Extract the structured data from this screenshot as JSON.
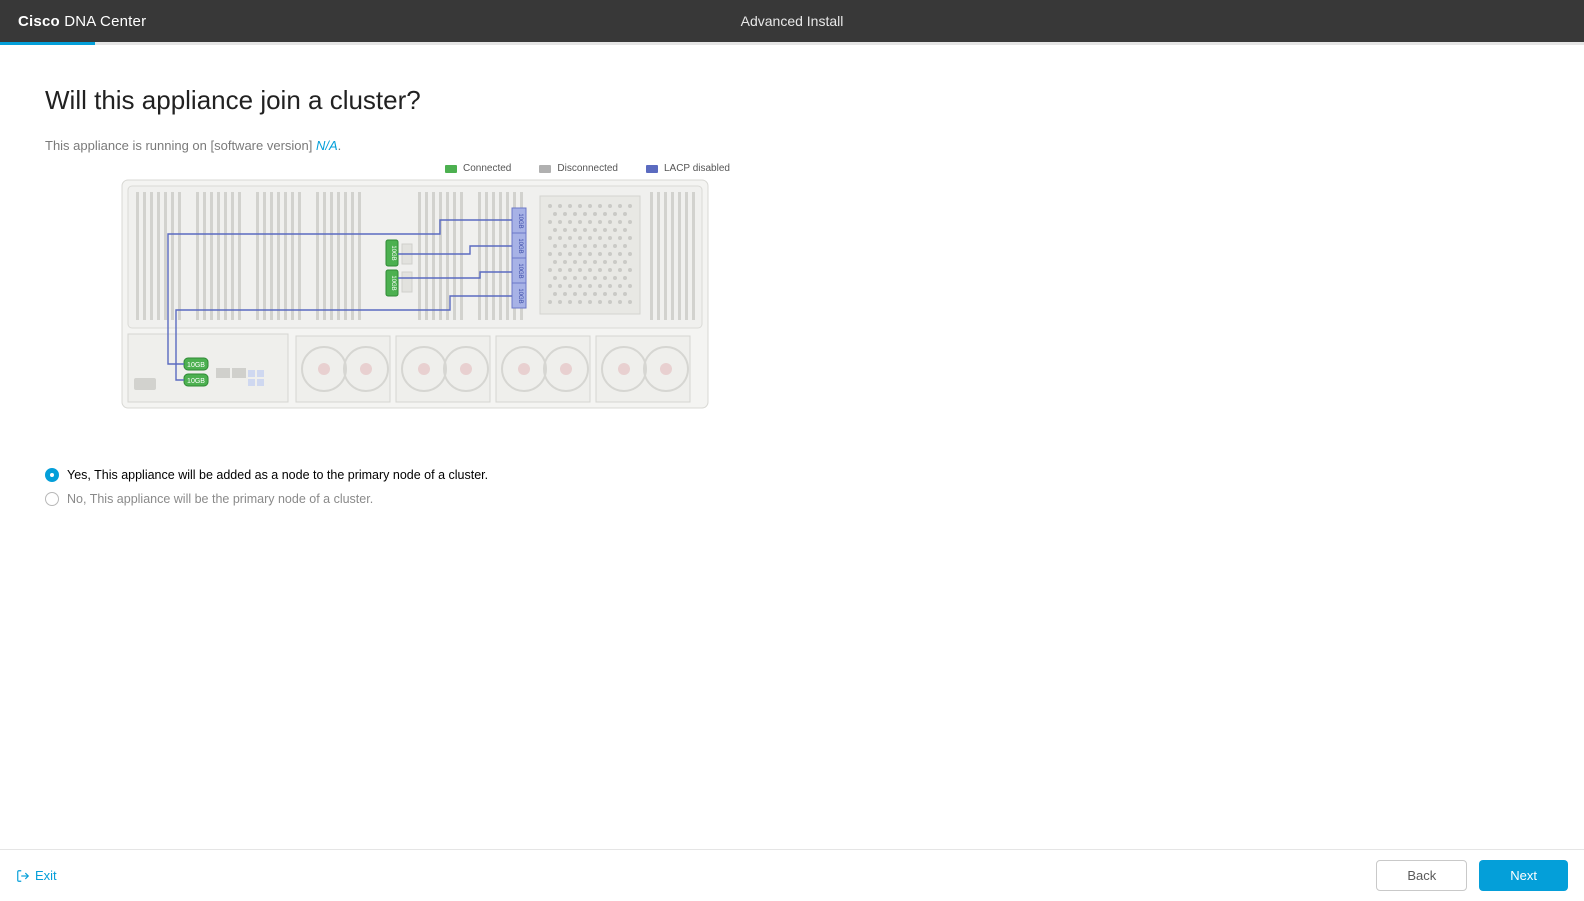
{
  "header": {
    "brand_bold": "Cisco",
    "brand_light": "DNA Center",
    "title": "Advanced Install"
  },
  "page": {
    "heading": "Will this appliance join a cluster?",
    "subtext_prefix": "This appliance is running on [software version] ",
    "subtext_link": "N/A",
    "subtext_suffix": "."
  },
  "legend": {
    "connected": "Connected",
    "disconnected": "Disconnected",
    "lacp": "LACP disabled"
  },
  "diagram": {
    "port_label": "10GB"
  },
  "options": {
    "yes": "Yes, This appliance will be added as a node to the primary node of a cluster.",
    "no": "No, This appliance will be the primary node of a cluster."
  },
  "footer": {
    "exit": "Exit",
    "back": "Back",
    "next": "Next"
  }
}
